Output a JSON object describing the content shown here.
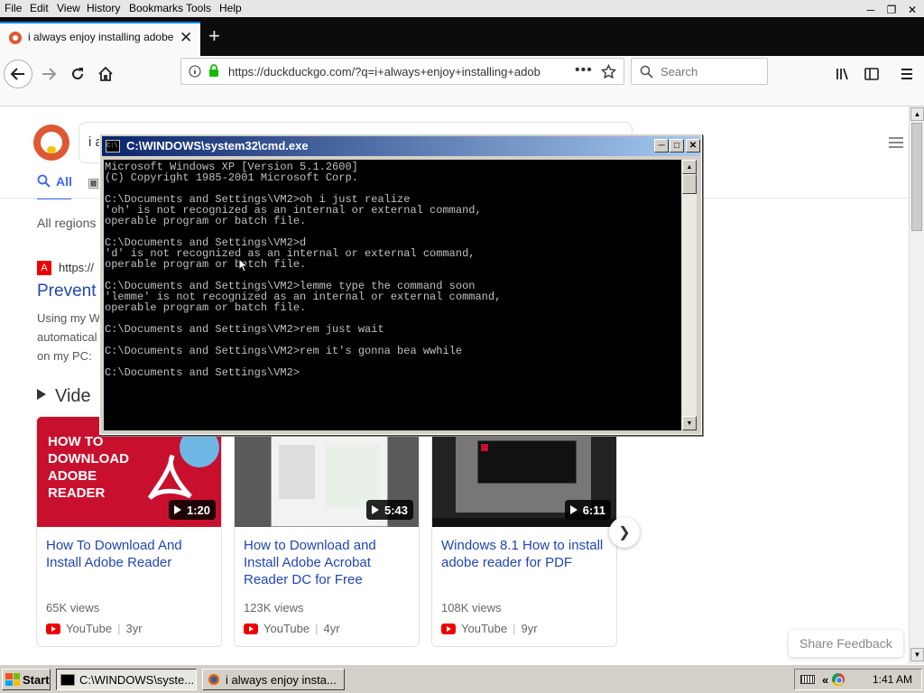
{
  "menubar": {
    "items": [
      "File",
      "Edit",
      "View",
      "History",
      "Bookmarks",
      "Tools",
      "Help"
    ]
  },
  "browser": {
    "tab_title": "i always enjoy installing adobe rea",
    "url": "https://duckduckgo.com/?q=i+always+enjoy+installing+adob",
    "search_placeholder": "Search",
    "accent_color": "#0a84ff"
  },
  "page": {
    "search_query_visible": "i a",
    "tab_all": "All",
    "regions": "All regions",
    "result": {
      "url_prefix": "https://",
      "title": "Prevent",
      "snippet_lines": [
        "Using my W",
        "automatical",
        "on my PC: "
      ]
    },
    "videos_heading": "Vide",
    "videos": [
      {
        "thumb_text": "HOW TO DOWNLOAD ADOBE READER",
        "duration": "1:20",
        "title": "How To Download And Install Adobe Reader",
        "views": "65K views",
        "source": "YouTube",
        "age": "3yr"
      },
      {
        "thumb_text": "",
        "duration": "5:43",
        "title": "How to Download and Install Adobe Acrobat Reader DC for Free",
        "views": "123K views",
        "source": "YouTube",
        "age": "4yr"
      },
      {
        "thumb_text": "",
        "duration": "6:11",
        "title": "Windows 8.1 How to install adobe reader for PDF",
        "views": "108K views",
        "source": "YouTube",
        "age": "9yr"
      }
    ],
    "share_feedback": "Share Feedback",
    "brand_color": "#de5833",
    "link_color": "#2145b5"
  },
  "cmd": {
    "title": "C:\\WINDOWS\\system32\\cmd.exe",
    "lines": [
      "Microsoft Windows XP [Version 5.1.2600]",
      "(C) Copyright 1985-2001 Microsoft Corp.",
      "",
      "C:\\Documents and Settings\\VM2>oh i just realize",
      "'oh' is not recognized as an internal or external command,",
      "operable program or batch file.",
      "",
      "C:\\Documents and Settings\\VM2>d",
      "'d' is not recognized as an internal or external command,",
      "operable program or batch file.",
      "",
      "C:\\Documents and Settings\\VM2>lemme type the command soon",
      "'lemme' is not recognized as an internal or external command,",
      "operable program or batch file.",
      "",
      "C:\\Documents and Settings\\VM2>rem just wait",
      "",
      "C:\\Documents and Settings\\VM2>rem it's gonna bea wwhile",
      "",
      "C:\\Documents and Settings\\VM2>"
    ]
  },
  "taskbar": {
    "start_label": "Start",
    "tasks": [
      {
        "label": "C:\\WINDOWS\\syste...",
        "active": true
      },
      {
        "label": "i always enjoy insta...",
        "active": false
      }
    ],
    "clock": "1:41 AM"
  }
}
